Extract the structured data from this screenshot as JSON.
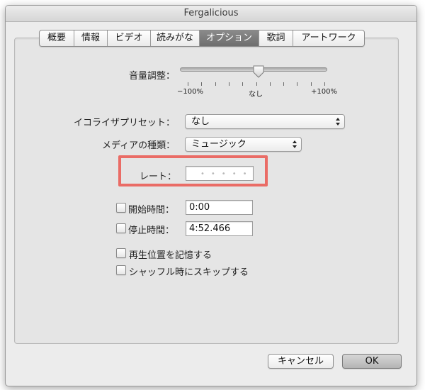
{
  "window": {
    "title": "Fergalicious"
  },
  "tabs": [
    {
      "label": "概要",
      "active": false
    },
    {
      "label": "情報",
      "active": false
    },
    {
      "label": "ビデオ",
      "active": false
    },
    {
      "label": "読みがな",
      "active": false
    },
    {
      "label": "オプション",
      "active": true
    },
    {
      "label": "歌詞",
      "active": false
    },
    {
      "label": "アートワーク",
      "active": false
    }
  ],
  "volume": {
    "label": "音量調整：",
    "min_label": "−100%",
    "mid_label": "なし",
    "max_label": "+100%",
    "value": 0
  },
  "equalizer": {
    "label": "イコライザプリセット：",
    "value": "なし"
  },
  "media_kind": {
    "label": "メディアの種類：",
    "value": "ミュージック"
  },
  "rating": {
    "label": "レート：",
    "dots": "•••••",
    "stars": 0
  },
  "start_time": {
    "label": "開始時間：",
    "value": "0:00",
    "checked": false
  },
  "stop_time": {
    "label": "停止時間：",
    "value": "4:52.466",
    "checked": false
  },
  "remember_position": {
    "label": "再生位置を記憶する",
    "checked": false
  },
  "skip_shuffle": {
    "label": "シャッフル時にスキップする",
    "checked": false
  },
  "buttons": {
    "cancel": "キャンセル",
    "ok": "OK"
  },
  "colors": {
    "highlight": "#ea6c66",
    "active_tab": "#7a7a7a"
  }
}
